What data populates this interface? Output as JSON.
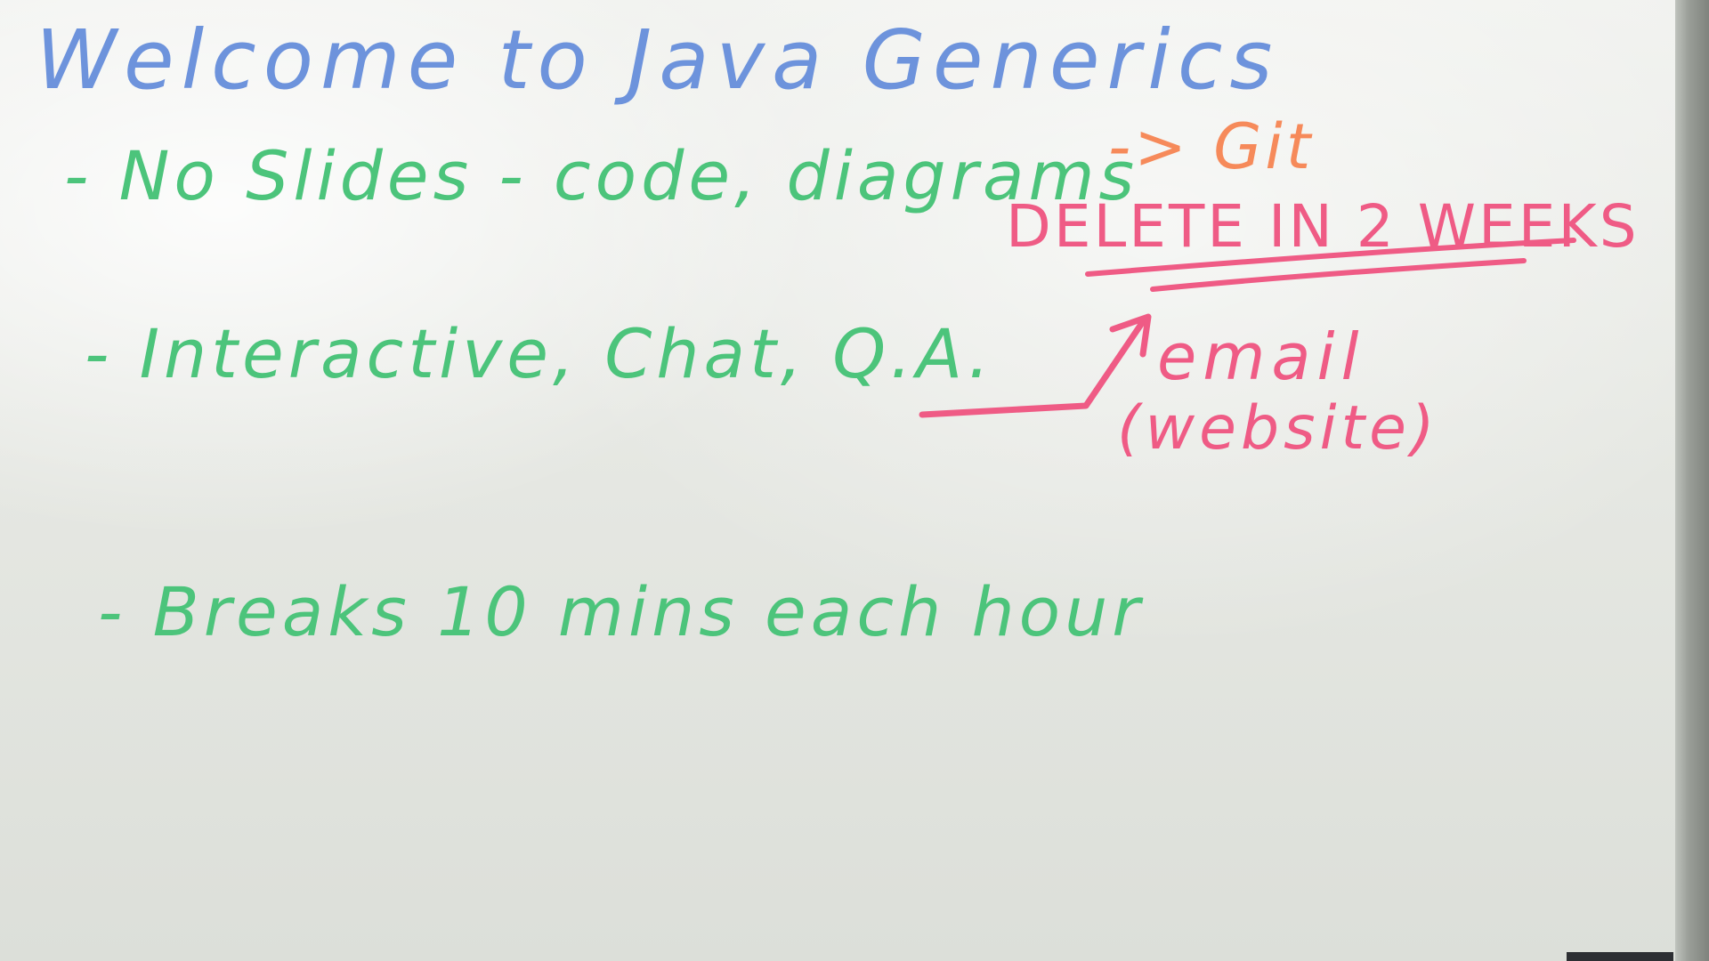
{
  "whiteboard": {
    "title": "Welcome to Java Generics",
    "items": [
      {
        "text": "- No Slides - code, diagrams"
      },
      {
        "text": "- Interactive, Chat, Q.A."
      },
      {
        "text": "- Breaks 10 mins each hour"
      }
    ],
    "git_note": "-> Git",
    "delete_note": "DELETE IN 2 WEEKS",
    "email_note": "email",
    "website_note": "(website)"
  },
  "colors": {
    "title": "#6d93dc",
    "bullets": "#4cc47b",
    "git": "#f68a5a",
    "notes": "#ef5b85"
  }
}
